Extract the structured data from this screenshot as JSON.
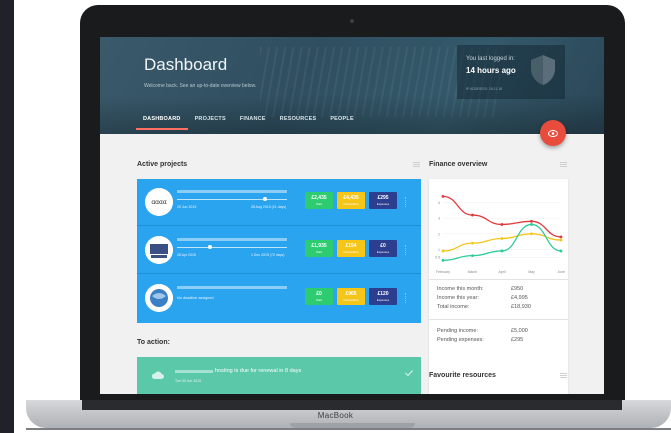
{
  "device": {
    "brand": "MacBook"
  },
  "header": {
    "title": "Dashboard",
    "subtitle": "Welcome back. See an up-to-date overview below.",
    "login_label": "You last logged in:",
    "login_value": "14 hours ago",
    "login_ip": "IP ADDRESS: 26.11.18"
  },
  "tabs": [
    "DASHBOARD",
    "PROJECTS",
    "FINANCE",
    "RESOURCES",
    "PEOPLE"
  ],
  "active_projects": {
    "title": "Active projects",
    "rows": [
      {
        "start": "25 Jun 2015",
        "end": "28 Aug 2015 (21 days)",
        "progress": 0.8,
        "paid": "£2,435",
        "paid_label": "Paid",
        "budget": "£4,435",
        "budget_label": "Outstanding",
        "expenses": "£295",
        "expenses_label": "Expenses"
      },
      {
        "start": "28 Apr 2015",
        "end": "1 Dec 2015 (72 days)",
        "progress": 0.3,
        "paid": "£1,935",
        "paid_label": "Paid",
        "budget": "£154",
        "budget_label": "Outstanding",
        "expenses": "£0",
        "expenses_label": "Expenses"
      },
      {
        "note": "No deadline assigned.",
        "paid": "£0",
        "paid_label": "Paid",
        "budget": "£965",
        "budget_label": "Outstanding",
        "expenses": "£120",
        "expenses_label": "Expenses"
      }
    ]
  },
  "finance": {
    "title": "Finance overview",
    "income_month_label": "Income this month:",
    "income_month": "£950",
    "income_year_label": "Income this year:",
    "income_year": "£4,995",
    "total_income_label": "Total income:",
    "total_income": "£18,930",
    "pending_income_label": "Pending income:",
    "pending_income": "£5,000",
    "pending_expenses_label": "Pending expenses:",
    "pending_expenses": "£295"
  },
  "chart_data": {
    "type": "line",
    "categories": [
      "February",
      "March",
      "April",
      "May",
      "June"
    ],
    "ylim": [
      0,
      5
    ],
    "yticks": [
      "0.5",
      "1",
      "2",
      "3",
      "4"
    ],
    "series": [
      {
        "color": "#e03a3a",
        "values": [
          4.4,
          3.2,
          2.6,
          2.8,
          1.8
        ]
      },
      {
        "color": "#f5c518",
        "values": [
          0.9,
          1.4,
          1.7,
          2.0,
          1.6
        ]
      },
      {
        "color": "#2ecc9a",
        "values": [
          0.3,
          0.6,
          0.9,
          2.6,
          0.9
        ]
      }
    ]
  },
  "to_action": {
    "title": "To action:",
    "text": "hosting is due for renewal in 8 days",
    "date": "Tue 30 Jun 2015"
  },
  "favourites": {
    "title": "Favourite resources"
  },
  "colors": {
    "primary": "#2aa4ef",
    "accent": "#e74c3c",
    "paid": "#2ecc71",
    "budget": "#f5c518",
    "expenses": "#2c3e8f",
    "action": "#5bc8a9"
  },
  "icons": [
    "shield-icon",
    "eye-icon",
    "cloud-icon",
    "check-icon",
    "menu-icon"
  ]
}
